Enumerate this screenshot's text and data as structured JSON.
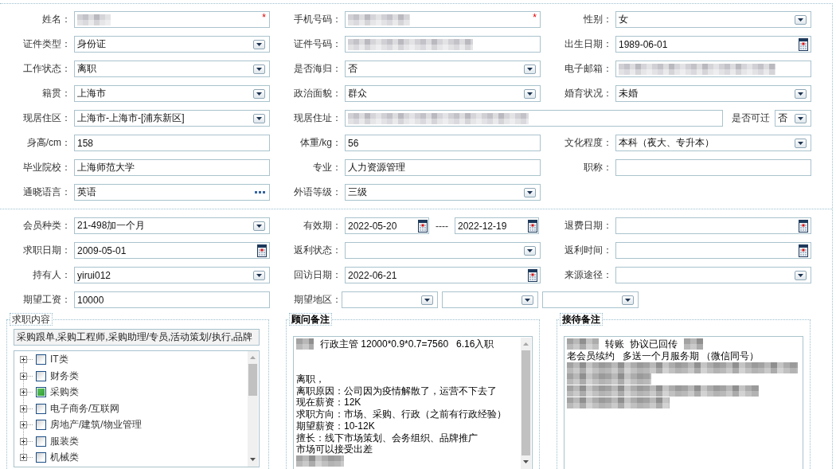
{
  "profile": {
    "rows": [
      [
        {
          "label": "姓名：",
          "kind": "text",
          "redacted": true,
          "required_mark": "*"
        },
        {
          "label": "手机号码：",
          "kind": "text",
          "redacted": true,
          "required_mark": "*"
        },
        {
          "label": "性别：",
          "kind": "select",
          "value": "女"
        }
      ],
      [
        {
          "label": "证件类型：",
          "kind": "select",
          "value": "身份证"
        },
        {
          "label": "证件号码：",
          "kind": "text",
          "redacted": true
        },
        {
          "label": "出生日期：",
          "kind": "date",
          "value": "1989-06-01"
        }
      ],
      [
        {
          "label": "工作状态：",
          "kind": "select",
          "value": "离职"
        },
        {
          "label": "是否海归：",
          "kind": "select",
          "value": "否"
        },
        {
          "label": "电子邮箱：",
          "kind": "text",
          "redacted": true
        }
      ],
      [
        {
          "label": "籍贯：",
          "kind": "select",
          "value": "上海市"
        },
        {
          "label": "政治面貌：",
          "kind": "select",
          "value": "群众"
        },
        {
          "label": "婚育状况：",
          "kind": "select",
          "value": "未婚"
        }
      ],
      [
        {
          "label": "现居住区：",
          "kind": "select",
          "value": "上海市-上海市-[浦东新区]"
        },
        {
          "label": "现居住址：",
          "kind": "text",
          "redacted": true,
          "extra": {
            "label": "是否可迁",
            "kind": "select",
            "value": "否"
          }
        }
      ],
      [
        {
          "label": "身高/cm：",
          "kind": "text",
          "value": "158"
        },
        {
          "label": "体重/kg：",
          "kind": "text",
          "value": "56"
        },
        {
          "label": "文化程度：",
          "kind": "select",
          "value": "本科（夜大、专升本）"
        }
      ],
      [
        {
          "label": "毕业院校：",
          "kind": "text",
          "value": "上海师范大学"
        },
        {
          "label": "专业：",
          "kind": "text",
          "value": "人力资源管理"
        },
        {
          "label": "职称：",
          "kind": "text"
        }
      ],
      [
        {
          "label": "通晓语言：",
          "kind": "lookup",
          "value": "英语"
        },
        {
          "label": "外语等级：",
          "kind": "select",
          "value": "三级"
        }
      ]
    ]
  },
  "membership": {
    "rows": [
      [
        {
          "label": "会员种类：",
          "kind": "select",
          "value": "21-498加一个月"
        },
        {
          "label": "有效期：",
          "kind": "date-range",
          "value": "2022-05-20",
          "separator": "----",
          "value_end": "2022-12-19"
        },
        {
          "label": "退费日期：",
          "kind": "date"
        }
      ],
      [
        {
          "label": "求职日期：",
          "kind": "date",
          "value": "2009-05-01"
        },
        {
          "label": "返利状态：",
          "kind": "select"
        },
        {
          "label": "返利时间：",
          "kind": "date"
        }
      ],
      [
        {
          "label": "持有人：",
          "kind": "select",
          "value": "yirui012"
        },
        {
          "label": "回访日期：",
          "kind": "date",
          "value": "2022-06-21"
        },
        {
          "label": "来源途径：",
          "kind": "select"
        }
      ],
      [
        {
          "label": "期望工资：",
          "kind": "text",
          "value": "10000"
        },
        {
          "label": "期望地区：",
          "kind": "multi-select",
          "parts": [
            {
              "kind": "select"
            },
            {
              "kind": "select"
            },
            {
              "kind": "select"
            }
          ]
        }
      ]
    ]
  },
  "job_intent": {
    "legend": "求职内容",
    "bold": false,
    "selected_jobs": "采购跟单,采购工程师,采购助理/专员,活动策划/执行,品牌",
    "scrollbar": true,
    "tree": [
      {
        "label": "IT类",
        "expanded": false,
        "checked": false
      },
      {
        "label": "财务类",
        "expanded": false,
        "checked": false
      },
      {
        "label": "采购类",
        "expanded": false,
        "checked": true
      },
      {
        "label": "电子商务/互联网",
        "expanded": false,
        "checked": false
      },
      {
        "label": "房地产/建筑/物业管理",
        "expanded": false,
        "checked": false
      },
      {
        "label": "服装类",
        "expanded": false,
        "checked": false
      },
      {
        "label": "机械类",
        "expanded": false,
        "checked": false
      }
    ]
  },
  "consultant_notes": {
    "legend": "顾问备注",
    "bold": true,
    "scrollbar": true,
    "lines": [
      {
        "kind": "text",
        "segments": [
          {
            "kind": "redacted"
          },
          {
            "kind": "text",
            "text": "行政主管 12000*0.9*0.7=7560   6.16入职"
          }
        ]
      },
      {
        "kind": "blank"
      },
      {
        "kind": "blank"
      },
      {
        "kind": "text",
        "segments": [
          {
            "kind": "text",
            "text": "离职，"
          }
        ]
      },
      {
        "kind": "text",
        "segments": [
          {
            "kind": "text",
            "text": "离职原因：公司因为疫情解散了，运营不下去了"
          }
        ]
      },
      {
        "kind": "text",
        "segments": [
          {
            "kind": "text",
            "text": "现在薪资：12K"
          }
        ]
      },
      {
        "kind": "text",
        "segments": [
          {
            "kind": "text",
            "text": "求职方向：市场、采购、行政（之前有行政经验）"
          }
        ]
      },
      {
        "kind": "text",
        "segments": [
          {
            "kind": "text",
            "text": "期望薪资：10-12K"
          }
        ]
      },
      {
        "kind": "text",
        "segments": [
          {
            "kind": "text",
            "text": "擅长：线下市场策划、会务组织、品牌推广"
          }
        ]
      },
      {
        "kind": "text",
        "segments": [
          {
            "kind": "text",
            "text": "市场可以接受出差"
          }
        ]
      },
      {
        "kind": "text",
        "segments": [
          {
            "kind": "redacted"
          }
        ]
      }
    ]
  },
  "reception_notes": {
    "legend": "接待备注",
    "bold": true,
    "lines": [
      {
        "kind": "text",
        "segments": [
          {
            "kind": "redacted"
          },
          {
            "kind": "text",
            "text": "转账  协议已回传"
          },
          {
            "kind": "redacted"
          }
        ]
      },
      {
        "kind": "text",
        "segments": [
          {
            "kind": "text",
            "text": "老会员续约   多送一个月服务期 （微信同号）"
          }
        ]
      },
      {
        "kind": "text",
        "segments": [
          {
            "kind": "redacted"
          }
        ]
      },
      {
        "kind": "text",
        "segments": [
          {
            "kind": "redacted"
          }
        ]
      },
      {
        "kind": "text",
        "segments": [
          {
            "kind": "redacted"
          }
        ]
      },
      {
        "kind": "text",
        "segments": [
          {
            "kind": "redacted"
          }
        ]
      }
    ]
  }
}
